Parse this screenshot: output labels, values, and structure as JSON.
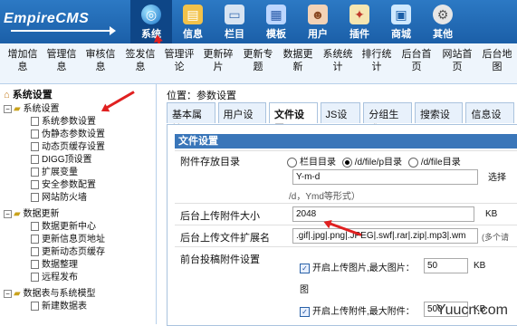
{
  "logo": "EmpireCMS",
  "topnav": [
    {
      "label": "系统",
      "icon": "globe-icon",
      "active": true
    },
    {
      "label": "信息",
      "icon": "document-icon"
    },
    {
      "label": "栏目",
      "icon": "folder-icon"
    },
    {
      "label": "模板",
      "icon": "template-icon"
    },
    {
      "label": "用户",
      "icon": "users-icon"
    },
    {
      "label": "插件",
      "icon": "plugin-icon"
    },
    {
      "label": "商城",
      "icon": "shop-icon"
    },
    {
      "label": "其他",
      "icon": "gear-icon"
    }
  ],
  "subnav": [
    "增加信息",
    "管理信息",
    "审核信息",
    "签发信息",
    "管理评论",
    "更新碎片",
    "更新专题",
    "数据更新",
    "系统统计",
    "排行统计",
    "后台首页",
    "网站首页",
    "后台地图"
  ],
  "sidebar": {
    "heading": "系统设置",
    "groups": [
      {
        "title": "系统设置",
        "items": [
          "系统参数设置",
          "伪静态参数设置",
          "动态页缓存设置",
          "DIGG顶设置",
          "扩展变量",
          "安全参数配置",
          "网站防火墙"
        ]
      },
      {
        "title": "数据更新",
        "items": [
          "数据更新中心",
          "更新信息页地址",
          "更新动态页缓存",
          "数据整理",
          "远程发布"
        ]
      },
      {
        "title": "数据表与系统模型",
        "items": [
          "新建数据表"
        ]
      }
    ]
  },
  "breadcrumb": "位置：参数设置",
  "tabs": [
    "基本属性",
    "用户设置",
    "文件设置",
    "JS设置",
    "分组生成",
    "搜索设置",
    "信息设置"
  ],
  "active_tab": "文件设置",
  "panel": {
    "title": "文件设置",
    "rows": {
      "attach_dir_label": "附件存放目录",
      "attach_dir_options": [
        "栏目目录",
        "/d/file/p目录",
        "/d/file目录"
      ],
      "attach_dir_selected": "/d/file/p目录",
      "date_format_value": "Y-m-d",
      "date_format_button": "选择",
      "date_format_hint": "/d，Ymd等形式）",
      "upload_size_label": "后台上传附件大小",
      "upload_size_value": "2048",
      "upload_size_unit": "KB",
      "ext_label": "后台上传文件扩展名",
      "ext_value": ".gif|.jpg|.png|.JPEG|.swf|.rar|.zip|.mp3|.wm",
      "ext_hint": "(多个请",
      "front_label": "前台投稿附件设置",
      "front_img_label": "开启上传图片,最大图片：",
      "front_img_value": "50",
      "front_img_unit": "KB",
      "front_img_prefix": "图",
      "front_attach_label": "开启上传附件,最大附件：",
      "front_attach_value": "500",
      "front_attach_unit": "KB"
    }
  },
  "watermark": "Yuucn.com"
}
